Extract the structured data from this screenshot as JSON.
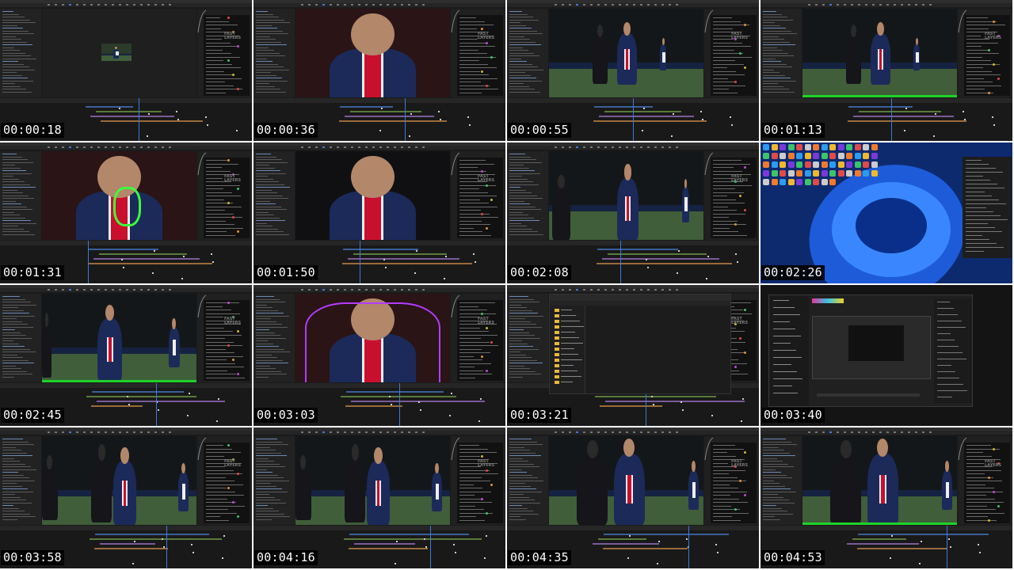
{
  "watermark": {
    "line1": "FAST",
    "line2": "LAYERS"
  },
  "accent": "#3d7bd9",
  "cells": [
    {
      "time": "00:00:18",
      "scene": "editor-small-preview",
      "playhead": 0.55
    },
    {
      "time": "00:00:36",
      "scene": "editor-closeup",
      "playhead": 0.6
    },
    {
      "time": "00:00:55",
      "scene": "editor-pitch-walk",
      "playhead": 0.5
    },
    {
      "time": "00:01:13",
      "scene": "editor-pitch-walk-green",
      "playhead": 0.52
    },
    {
      "time": "00:01:31",
      "scene": "editor-closeup-glow",
      "playhead": 0.35
    },
    {
      "time": "00:01:50",
      "scene": "editor-closeup-dark",
      "playhead": 0.42
    },
    {
      "time": "00:02:08",
      "scene": "editor-pitch-wide",
      "playhead": 0.45
    },
    {
      "time": "00:02:26",
      "scene": "desktop",
      "playhead": 0
    },
    {
      "time": "00:02:45",
      "scene": "editor-pitch-left",
      "playhead": 0.62
    },
    {
      "time": "00:03:03",
      "scene": "editor-closeup-purple",
      "playhead": 0.58
    },
    {
      "time": "00:03:21",
      "scene": "file-explorer",
      "playhead": 0.55
    },
    {
      "time": "00:03:40",
      "scene": "plugin-window",
      "playhead": 0
    },
    {
      "time": "00:03:58",
      "scene": "editor-two-players",
      "playhead": 0.66
    },
    {
      "time": "00:04:16",
      "scene": "editor-two-players-b",
      "playhead": 0.7
    },
    {
      "time": "00:04:35",
      "scene": "editor-masked",
      "playhead": 0.72
    },
    {
      "time": "00:04:53",
      "scene": "editor-masked-green",
      "playhead": 0.74
    }
  ]
}
